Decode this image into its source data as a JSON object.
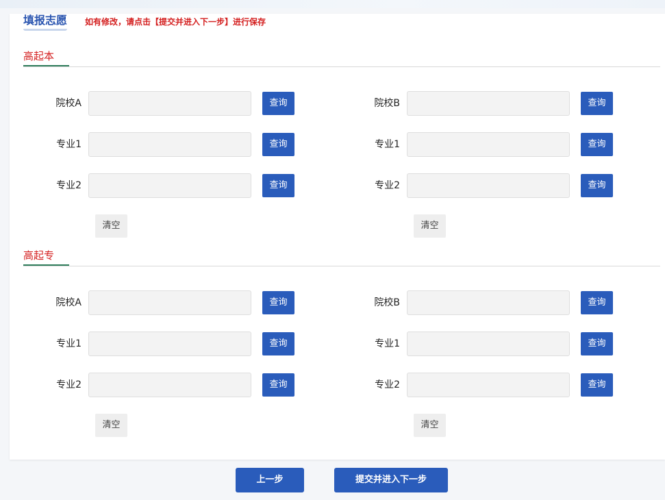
{
  "header": {
    "title": "填报志愿",
    "notice": "如有修改，请点击【提交并进入下一步】进行保存"
  },
  "sections": [
    {
      "title": "高起本",
      "left": {
        "school_label": "院校A",
        "major1_label": "专业1",
        "major2_label": "专业2",
        "school_value": "",
        "major1_value": "",
        "major2_value": ""
      },
      "right": {
        "school_label": "院校B",
        "major1_label": "专业1",
        "major2_label": "专业2",
        "school_value": "",
        "major1_value": "",
        "major2_value": ""
      }
    },
    {
      "title": "高起专",
      "left": {
        "school_label": "院校A",
        "major1_label": "专业1",
        "major2_label": "专业2",
        "school_value": "",
        "major1_value": "",
        "major2_value": ""
      },
      "right": {
        "school_label": "院校B",
        "major1_label": "专业1",
        "major2_label": "专业2",
        "school_value": "",
        "major1_value": "",
        "major2_value": ""
      }
    }
  ],
  "buttons": {
    "query": "查询",
    "clear": "清空",
    "prev": "上一步",
    "submit": "提交并进入下一步"
  },
  "colors": {
    "primary": "#2a5cbb",
    "title_blue": "#2a55b0",
    "notice_red": "#d42020",
    "section_underline": "#2e7d5b"
  }
}
